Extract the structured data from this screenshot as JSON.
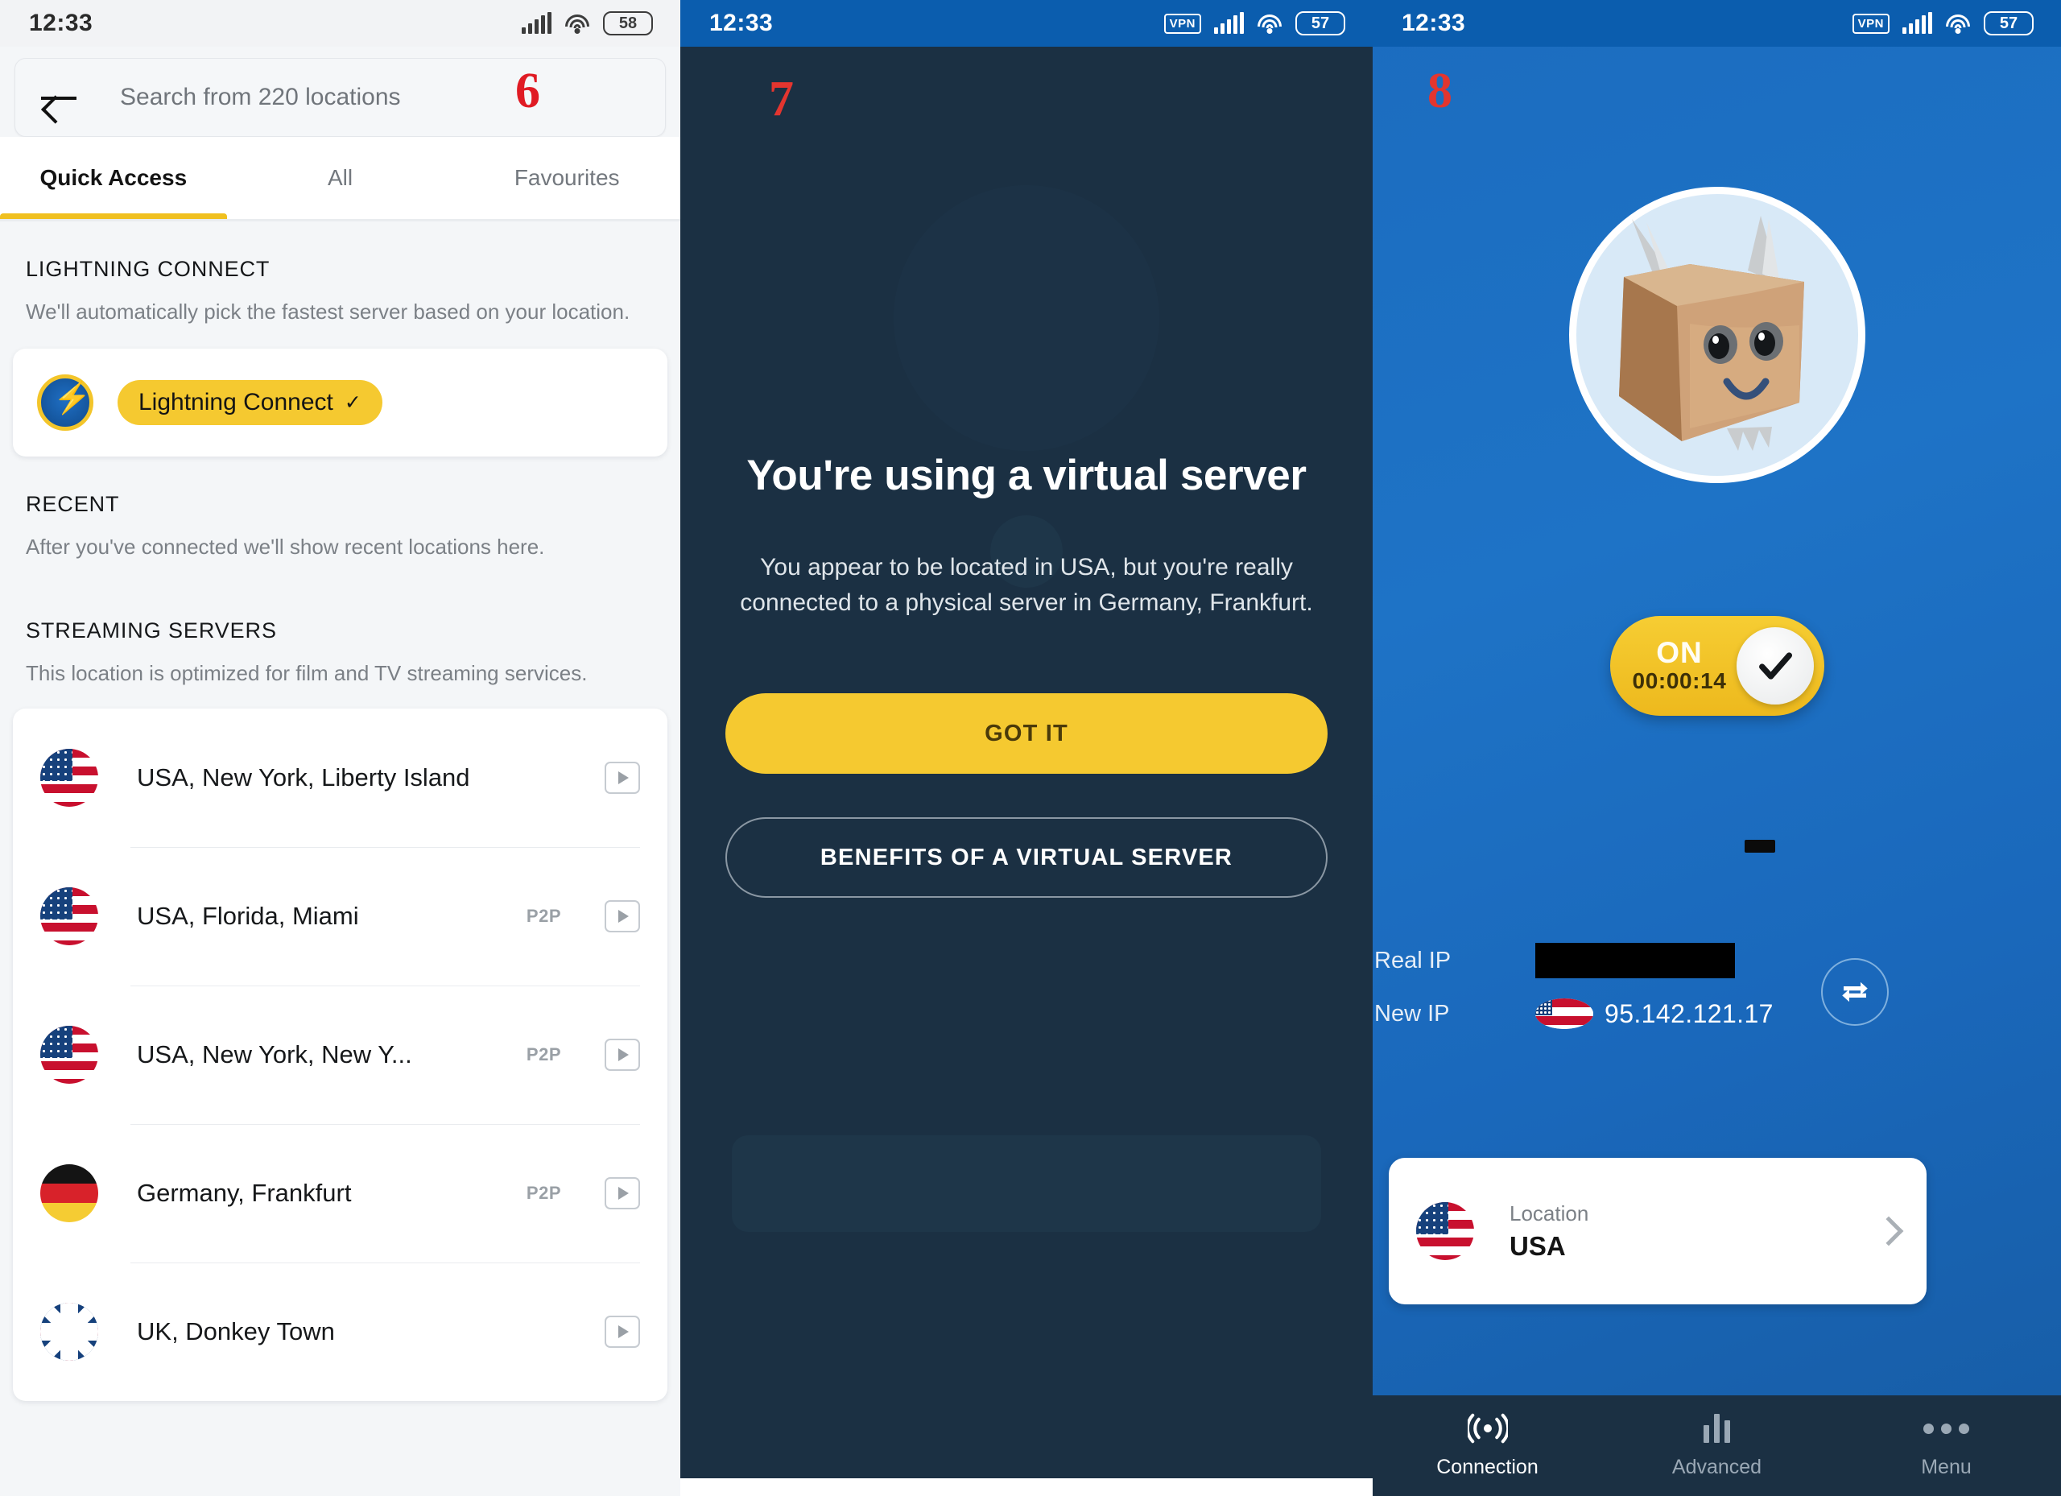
{
  "panel_locations": {
    "annotation": "6",
    "status_bar": {
      "time": "12:33",
      "battery": "58",
      "icons": [
        "signal-icon",
        "wifi-icon",
        "battery-icon"
      ]
    },
    "search": {
      "placeholder": "Search from 220 locations",
      "back_icon": "back-arrow-icon"
    },
    "tabs": [
      {
        "label": "Quick Access",
        "active": true
      },
      {
        "label": "All",
        "active": false
      },
      {
        "label": "Favourites",
        "active": false
      }
    ],
    "sections": {
      "lightning": {
        "title": "LIGHTNING CONNECT",
        "description": "We'll automatically pick the fastest server based on your location.",
        "chip_label": "Lightning Connect",
        "chip_check": "✓"
      },
      "recent": {
        "title": "RECENT",
        "description": "After you've connected we'll show recent locations here."
      },
      "streaming": {
        "title": "STREAMING SERVERS",
        "description": "This location is optimized for film and TV streaming services."
      }
    },
    "servers": [
      {
        "flag": "us",
        "name": "USA, New York, Liberty Island",
        "p2p": ""
      },
      {
        "flag": "us",
        "name": "USA, Florida, Miami",
        "p2p": "P2P"
      },
      {
        "flag": "us",
        "name": "USA, New York, New Y...",
        "p2p": "P2P"
      },
      {
        "flag": "de",
        "name": "Germany, Frankfurt",
        "p2p": "P2P"
      },
      {
        "flag": "uk",
        "name": "UK, Donkey Town",
        "p2p": ""
      }
    ]
  },
  "panel_virtual_server": {
    "annotation": "7",
    "status_bar": {
      "time": "12:33",
      "battery": "57",
      "vpn": "VPN"
    },
    "title": "You're using a virtual server",
    "description": "You appear to be located in USA, but you're really connected to a physical server in Germany, Frankfurt.",
    "primary_button": "GOT IT",
    "secondary_button": "BENEFITS OF A VIRTUAL SERVER"
  },
  "panel_connection": {
    "annotation": "8",
    "status_bar": {
      "time": "12:33",
      "battery": "57",
      "vpn": "VPN"
    },
    "mascot": "cardboard-box-cat-mascot",
    "toggle": {
      "state": "ON",
      "timer": "00:00:14",
      "knob_icon": "check-icon"
    },
    "ip": {
      "real_label": "Real IP",
      "real_value": "",
      "new_label": "New IP",
      "new_value": "95.142.121.17",
      "new_flag": "us",
      "refresh_icon": "shuffle-icon"
    },
    "location_card": {
      "caption": "Location",
      "value": "USA",
      "flag": "us",
      "chevron": "chevron-right-icon"
    },
    "nav": [
      {
        "label": "Connection",
        "icon": "broadcast-icon",
        "active": true
      },
      {
        "label": "Advanced",
        "icon": "bar-chart-icon",
        "active": false
      },
      {
        "label": "Menu",
        "icon": "more-dots-icon",
        "active": false
      }
    ]
  },
  "colors": {
    "accent_yellow": "#f5c930",
    "brand_blue": "#1b6cbf",
    "dark_navy": "#1b3043",
    "annotation_red": "#e01b24"
  }
}
